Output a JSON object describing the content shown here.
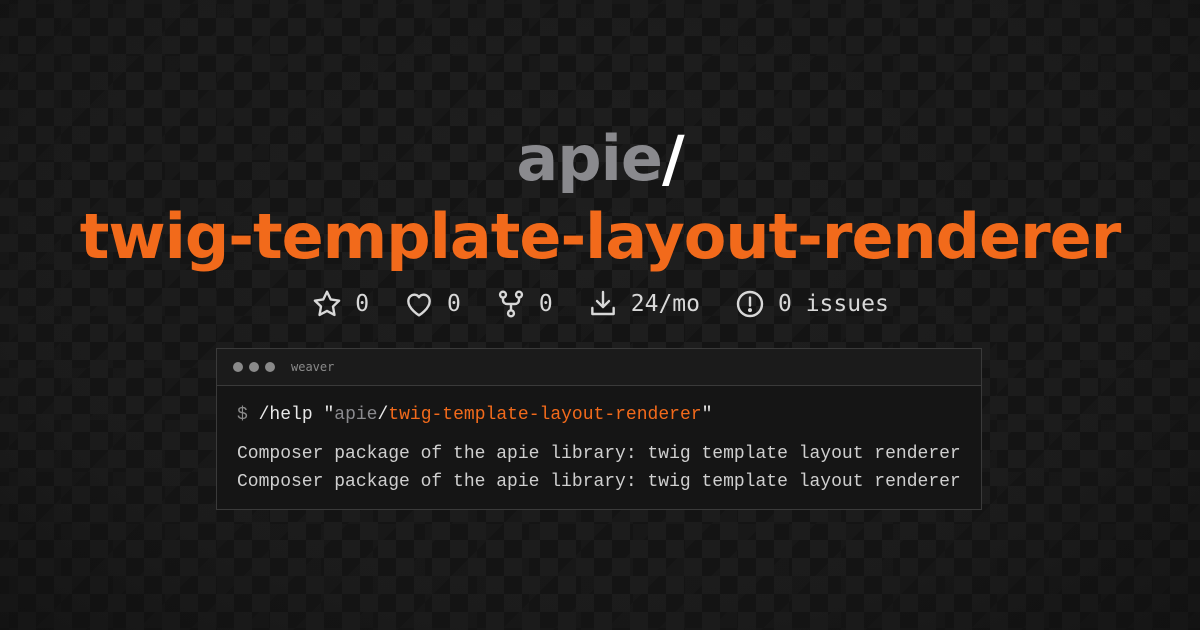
{
  "title": {
    "owner": "apie",
    "slash": "/",
    "package": "twig-template-layout-renderer"
  },
  "stats": {
    "stars": "0",
    "likes": "0",
    "forks": "0",
    "downloads": "24/mo",
    "issues": "0 issues"
  },
  "terminal": {
    "window_title": "weaver",
    "prompt": "$",
    "command": "/help",
    "quote_open": "\"",
    "arg_owner": "apie",
    "arg_slash": "/",
    "arg_package": "twig-template-layout-renderer",
    "quote_close": "\"",
    "output": [
      "Composer package of the apie library: twig template layout renderer",
      "Composer package of the apie library: twig template layout renderer"
    ]
  },
  "colors": {
    "accent": "#f26a1b",
    "owner_gray": "#8a8a8e",
    "background": "#141414"
  },
  "icons": [
    "star-icon",
    "heart-icon",
    "fork-icon",
    "download-icon",
    "issue-icon"
  ]
}
